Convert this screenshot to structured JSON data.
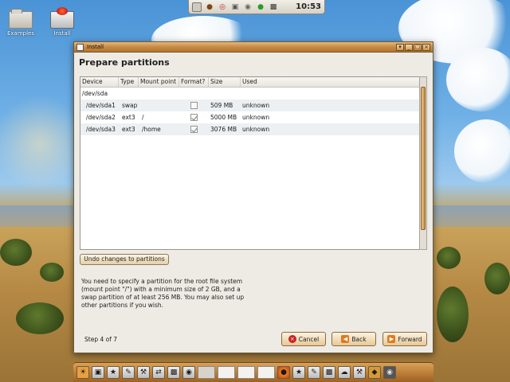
{
  "desktop": {
    "icons": [
      {
        "label": "Examples"
      },
      {
        "label": "Install"
      }
    ]
  },
  "top_panel": {
    "clock": "10:53"
  },
  "window": {
    "title": "Install",
    "heading": "Prepare partitions",
    "table": {
      "columns": [
        "Device",
        "Type",
        "Mount point",
        "Format?",
        "Size",
        "Used"
      ],
      "disk": "/dev/sda",
      "rows": [
        {
          "device": "/dev/sda1",
          "type": "swap",
          "mount": "",
          "format": false,
          "size": "509 MB",
          "used": "unknown"
        },
        {
          "device": "/dev/sda2",
          "type": "ext3",
          "mount": "/",
          "format": true,
          "size": "5000 MB",
          "used": "unknown"
        },
        {
          "device": "/dev/sda3",
          "type": "ext3",
          "mount": "/home",
          "format": true,
          "size": "3076 MB",
          "used": "unknown"
        }
      ]
    },
    "undo_label": "Undo changes to partitions",
    "info_text": "You need to specify a partition for the root file system (mount point \"/\") with a minimum size of 2 GB, and a swap partition of at least 256 MB. You may also set up other partitions if you wish.",
    "step": "Step 4 of 7",
    "buttons": {
      "cancel": "Cancel",
      "back": "Back",
      "forward": "Forward"
    }
  },
  "colors": {
    "titlebar": "#c88a45",
    "button_face": "#e7c896",
    "cancel_icon": "#cc2222",
    "nav_icon": "#e07a1e"
  }
}
